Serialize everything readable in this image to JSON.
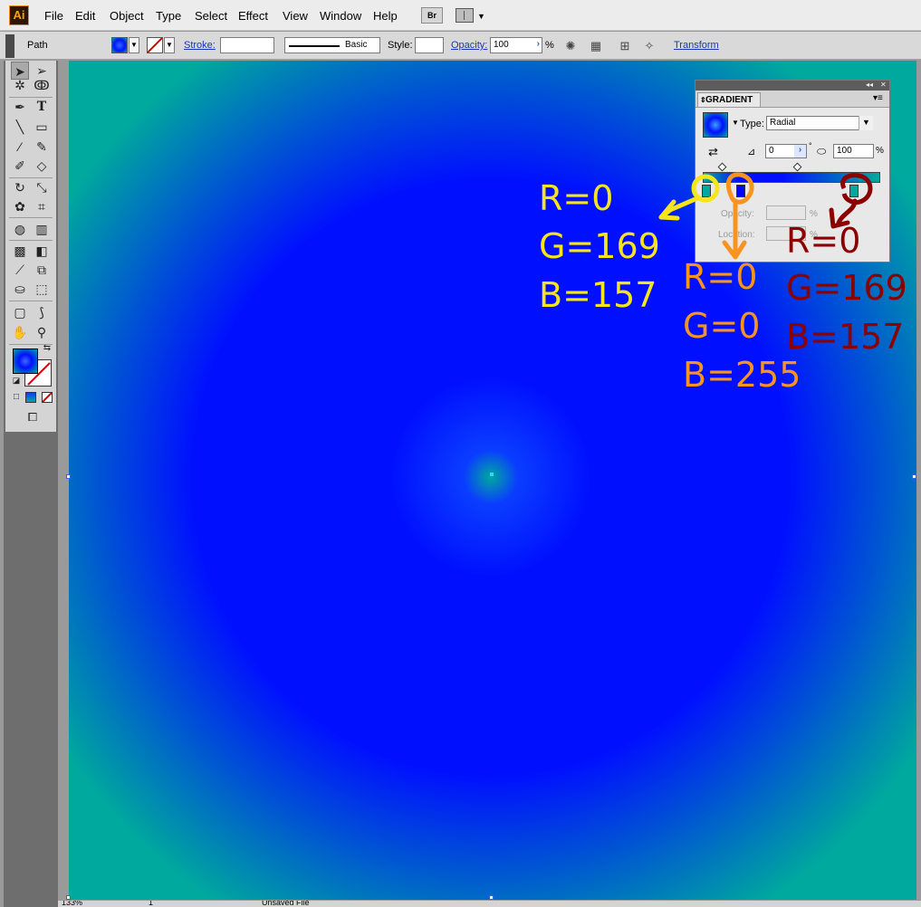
{
  "app": {
    "logo": "Ai"
  },
  "menu": [
    "File",
    "Edit",
    "Object",
    "Type",
    "Select",
    "Effect",
    "View",
    "Window",
    "Help"
  ],
  "menubar_buttons": {
    "bridge": "Br"
  },
  "control_bar": {
    "object_type": "Path",
    "stroke_label": "Stroke:",
    "stroke_profile": "Basic",
    "style_label": "Style:",
    "opacity_label": "Opacity:",
    "opacity_value": "100",
    "opacity_unit": "%",
    "transform_label": "Transform"
  },
  "gradient_panel": {
    "title": "GRADIENT",
    "type_label": "Type:",
    "type_value": "Radial",
    "angle_value": "0",
    "angle_unit": "°",
    "aspect_value": "100",
    "aspect_unit": "%",
    "opacity_label": "Opacity:",
    "opacity_unit": "%",
    "location_label": "Location:",
    "location_unit": "%"
  },
  "annotations": {
    "yellow": {
      "r": "R=0",
      "g": "G=169",
      "b": "B=157",
      "color": "#f5e51a"
    },
    "orange": {
      "r": "R=0",
      "g": "G=0",
      "b": "B=255",
      "color": "#f7931e"
    },
    "darkred": {
      "r": "R=0",
      "g": "G=169",
      "b": "B=157",
      "color": "#8b0000"
    }
  },
  "colors": {
    "gradient_stop_teal": "#00a99d",
    "gradient_stop_blue": "#0000ff",
    "canvas_teal": "#00a99d"
  },
  "statusbar": {
    "zoom": "133%",
    "page": "1",
    "file_status": "Unsaved File"
  }
}
